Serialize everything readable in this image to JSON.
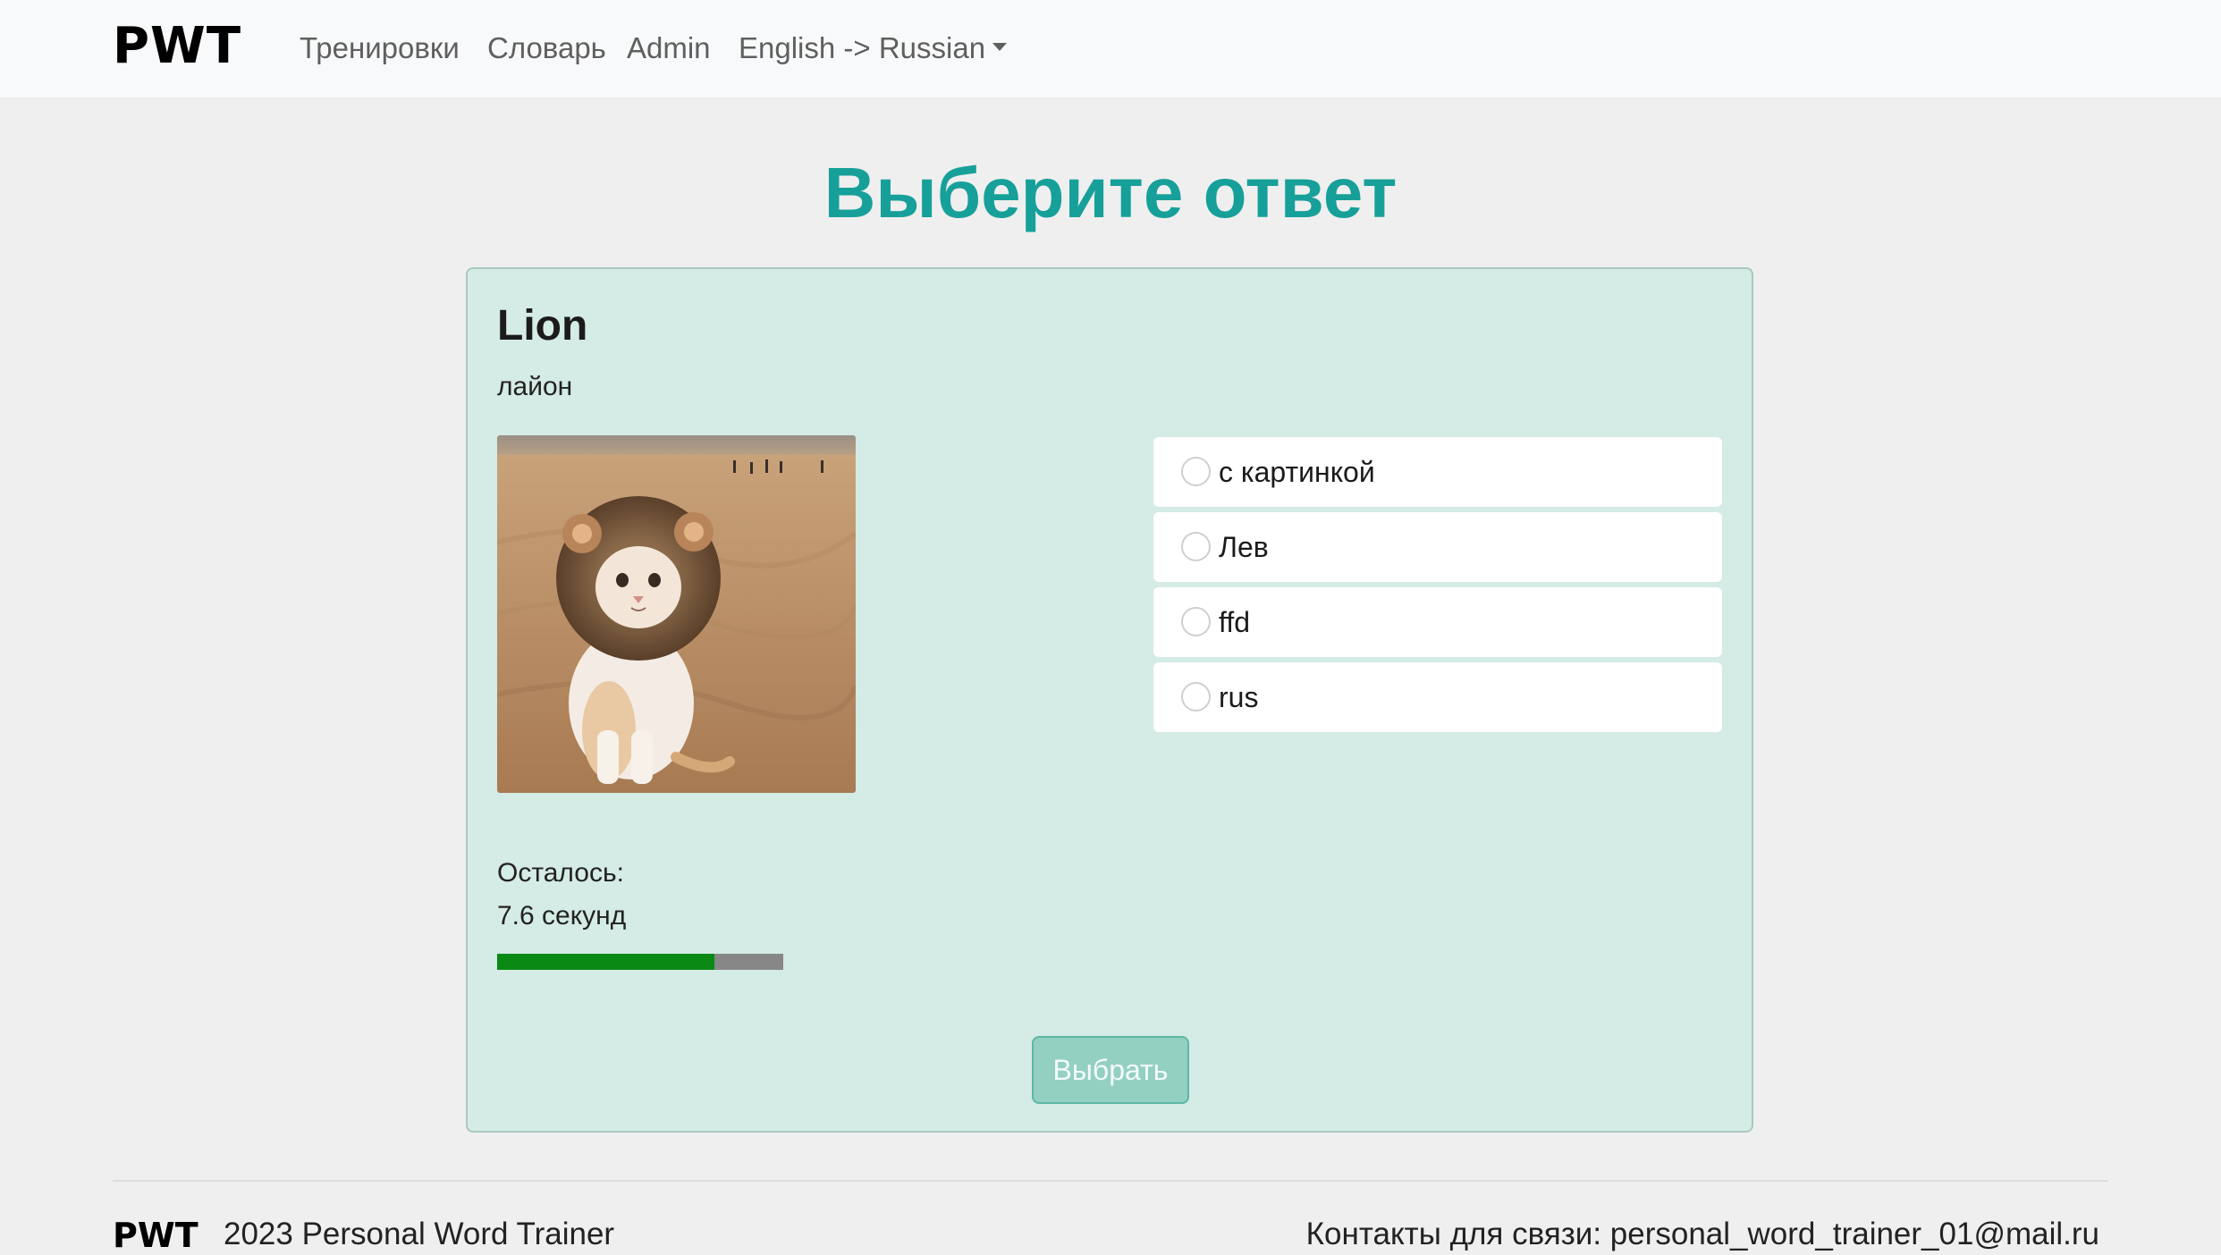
{
  "navbar": {
    "brand": "PWT",
    "links": [
      "Тренировки",
      "Словарь",
      "Admin"
    ],
    "language_dropdown": "English -> Russian"
  },
  "page": {
    "title": "Выберите ответ"
  },
  "quiz": {
    "word": "Lion",
    "transcription": "лайон",
    "image_icon": "cat-in-lion-mane-photo",
    "options": [
      "с картинкой",
      "Лев",
      "ffd",
      "rus"
    ],
    "timer_label": "Осталось:",
    "timer_value": "7.6 секунд",
    "time_remaining_fraction": 0.76,
    "submit_label": "Выбрать"
  },
  "footer": {
    "brand": "PWT",
    "text": "2023 Personal Word Trainer",
    "contact": "Контакты для связи: personal_word_trainer_01@mail.ru"
  },
  "colors": {
    "accent": "#17a09a",
    "card_bg": "#d5ebe5",
    "progress_fill": "#0a8a14",
    "progress_bg": "#878787",
    "button_bg": "#94d0c2"
  }
}
